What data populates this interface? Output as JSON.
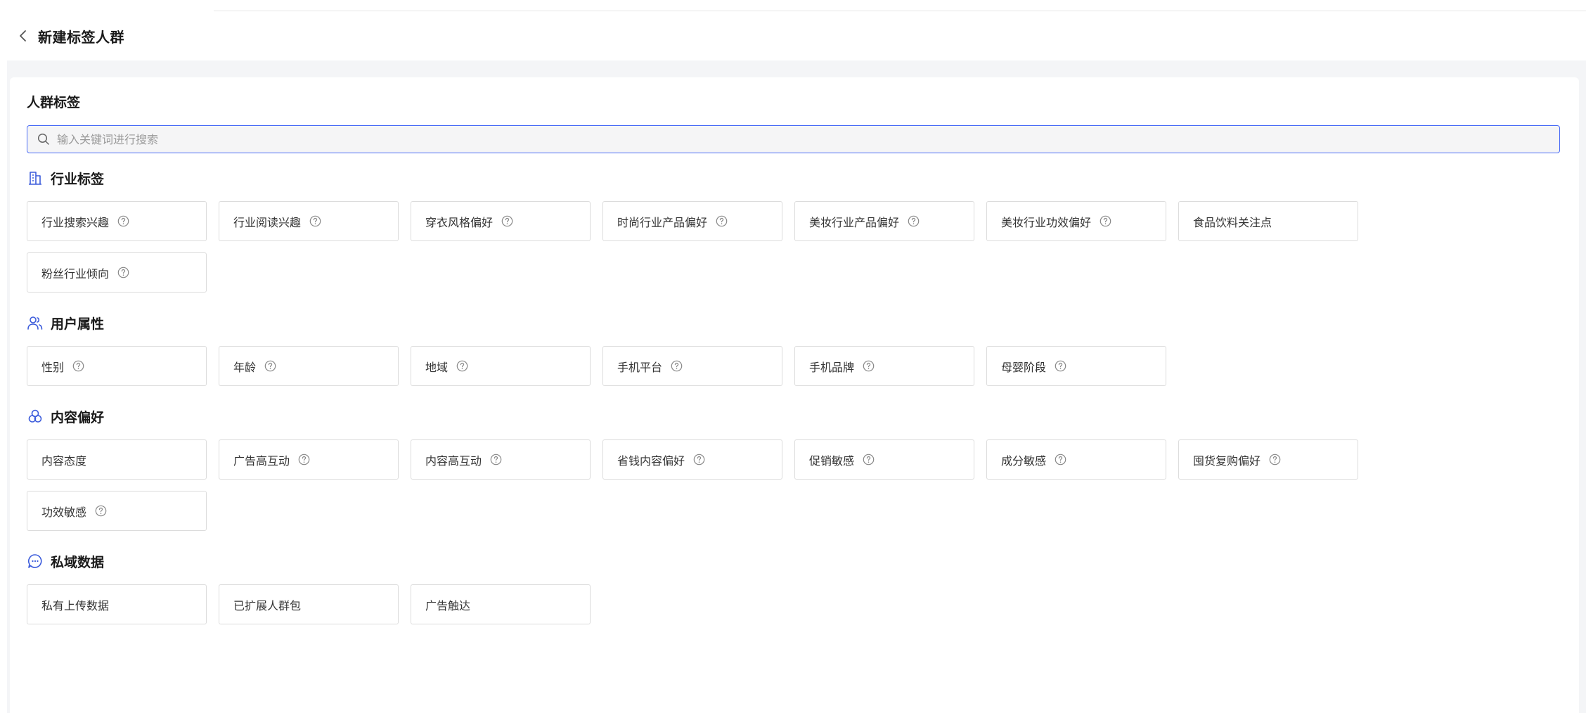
{
  "header": {
    "title": "新建标签人群"
  },
  "card": {
    "title": "人群标签"
  },
  "search": {
    "placeholder": "输入关键词进行搜索",
    "value": ""
  },
  "colors": {
    "accent": "#4a6cf7",
    "border": "#dcdcdc",
    "background": "#f4f5f7"
  },
  "sections": [
    {
      "title": "行业标签",
      "icon": "building-icon",
      "tags": [
        {
          "label": "行业搜索兴趣",
          "help": true
        },
        {
          "label": "行业阅读兴趣",
          "help": true
        },
        {
          "label": "穿衣风格偏好",
          "help": true
        },
        {
          "label": "时尚行业产品偏好",
          "help": true
        },
        {
          "label": "美妆行业产品偏好",
          "help": true
        },
        {
          "label": "美妆行业功效偏好",
          "help": true
        },
        {
          "label": "食品饮料关注点",
          "help": false
        },
        {
          "label": "粉丝行业倾向",
          "help": true
        }
      ]
    },
    {
      "title": "用户属性",
      "icon": "users-icon",
      "tags": [
        {
          "label": "性别",
          "help": true
        },
        {
          "label": "年龄",
          "help": true
        },
        {
          "label": "地域",
          "help": true
        },
        {
          "label": "手机平台",
          "help": true
        },
        {
          "label": "手机品牌",
          "help": true
        },
        {
          "label": "母婴阶段",
          "help": true
        }
      ]
    },
    {
      "title": "内容偏好",
      "icon": "three-circles-icon",
      "tags": [
        {
          "label": "内容态度",
          "help": false
        },
        {
          "label": "广告高互动",
          "help": true
        },
        {
          "label": "内容高互动",
          "help": true
        },
        {
          "label": "省钱内容偏好",
          "help": true
        },
        {
          "label": "促销敏感",
          "help": true
        },
        {
          "label": "成分敏感",
          "help": true
        },
        {
          "label": "囤货复购偏好",
          "help": true
        },
        {
          "label": "功效敏感",
          "help": true
        }
      ]
    },
    {
      "title": "私域数据",
      "icon": "chat-bubble-icon",
      "tags": [
        {
          "label": "私有上传数据",
          "help": false
        },
        {
          "label": "已扩展人群包",
          "help": false
        },
        {
          "label": "广告触达",
          "help": false
        }
      ]
    }
  ]
}
